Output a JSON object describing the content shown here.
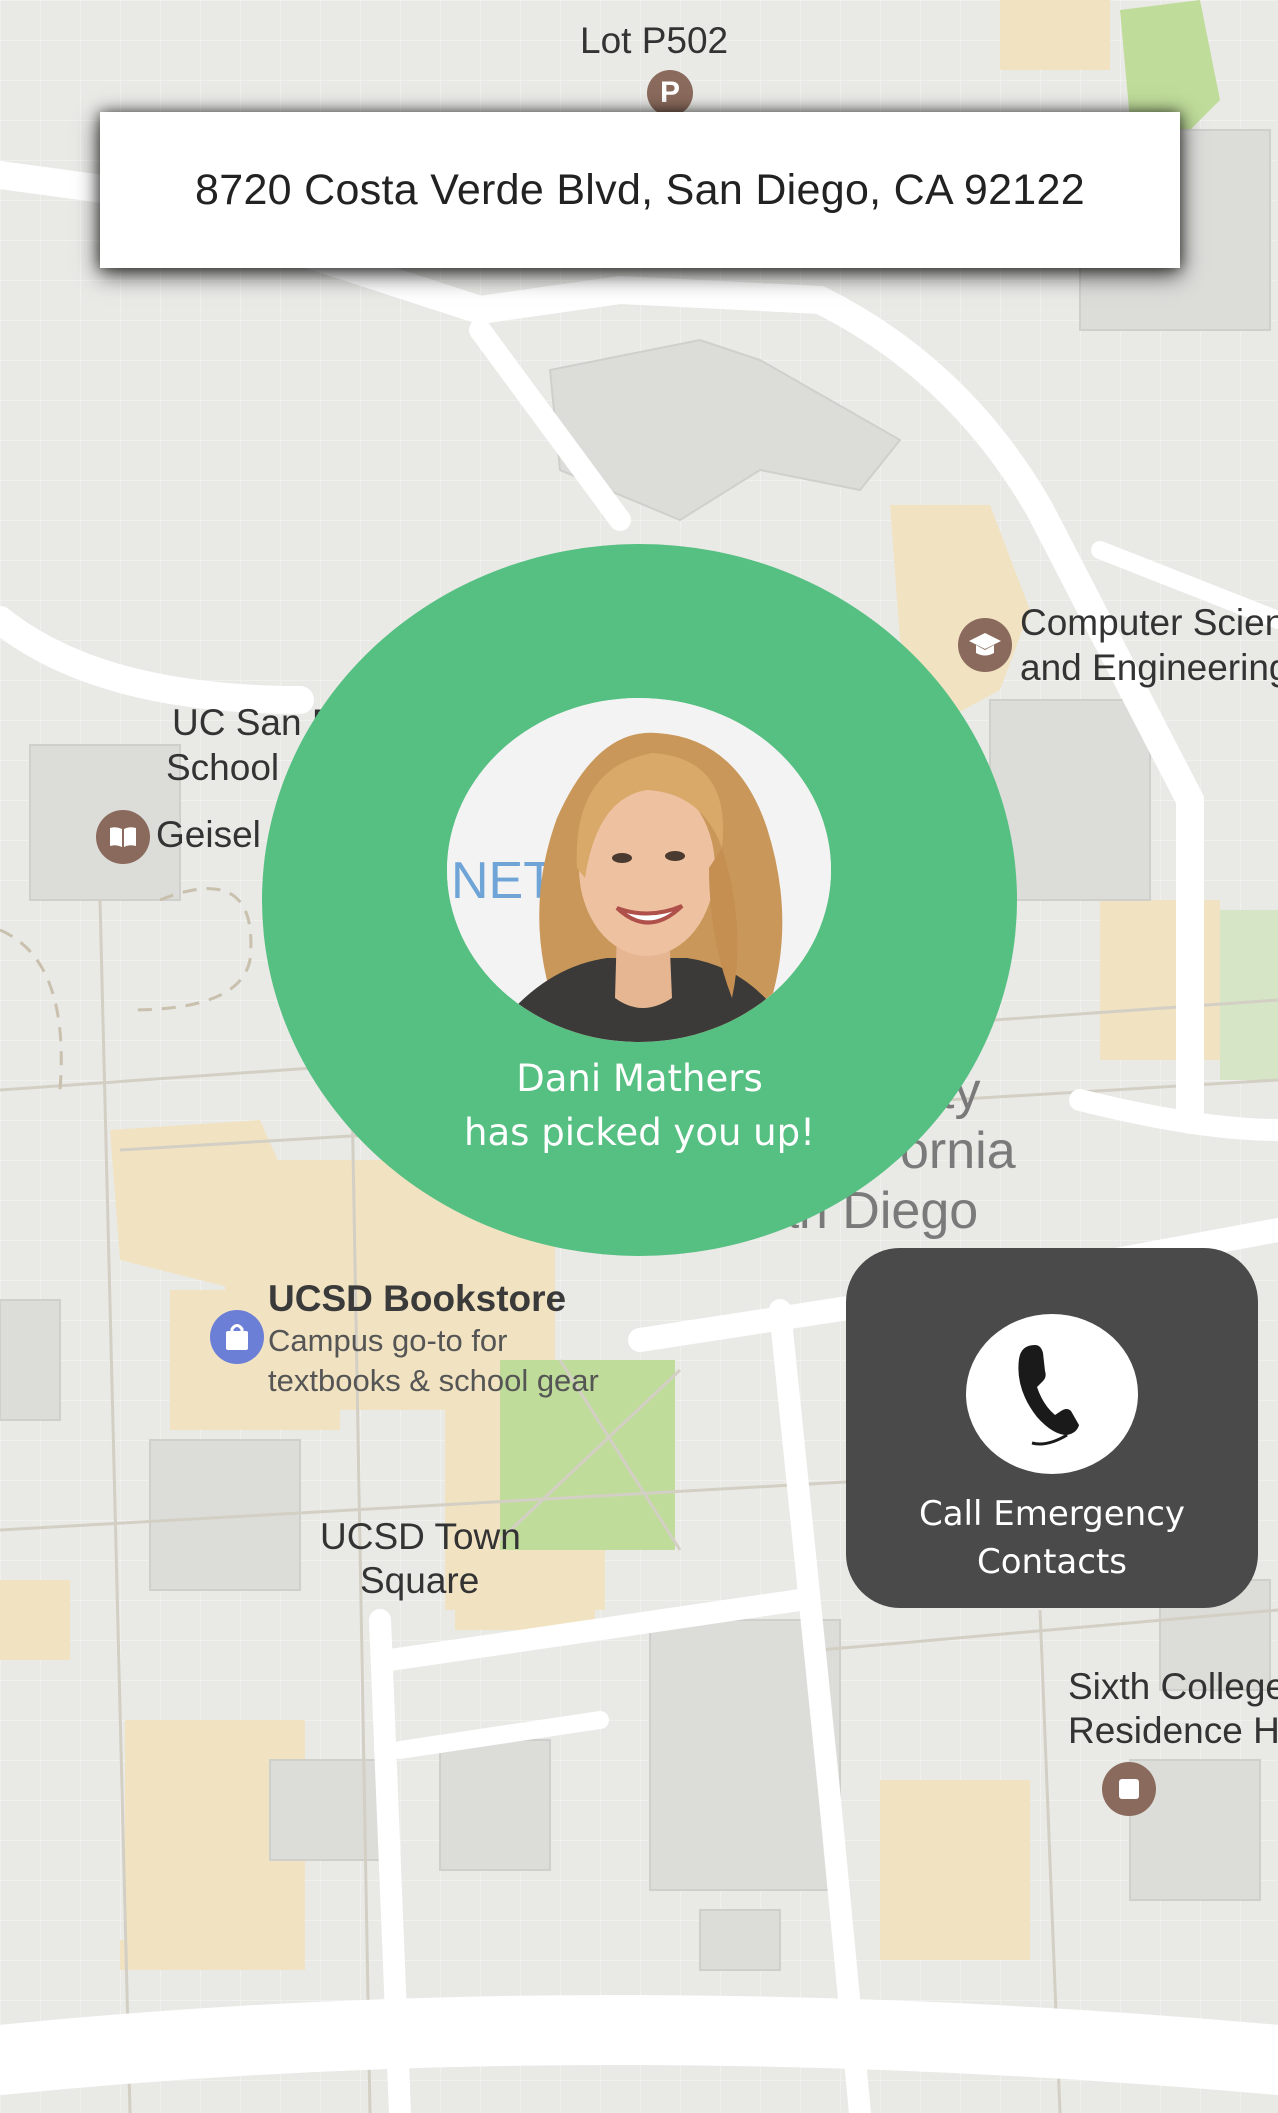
{
  "map": {
    "labels": {
      "lot": "Lot P502",
      "cse_line1": "Computer Scien",
      "cse_line2": "and Engineering",
      "ucsd_school_line1": "UC San D",
      "ucsd_school_line2": "School",
      "geisel": "Geisel",
      "bookstore_title": "UCSD Bookstore",
      "bookstore_desc_line1": "Campus go-to for",
      "bookstore_desc_line2": "textbooks & school gear",
      "town_square_line1": "UCSD Town",
      "town_square_line2": "Square",
      "sixth_line1": "Sixth College",
      "sixth_line2": "Residence H",
      "campus_line1": "ty",
      "campus_line2": "ornia",
      "campus_line3": "an Diego"
    },
    "icons": {
      "parking": "parking-icon",
      "graduation": "graduation-cap-icon",
      "library": "book-icon",
      "shopping": "shopping-bag-icon",
      "residence": "building-icon"
    }
  },
  "address": {
    "text": "8720 Costa Verde Blvd, San Diego, CA 92122"
  },
  "pickup": {
    "driver_name": "Dani Mathers",
    "message": "has picked you up!",
    "shirt_text": "NET"
  },
  "emergency": {
    "label_line1": "Call Emergency",
    "label_line2": "Contacts"
  },
  "colors": {
    "accent_green": "#56bf82",
    "emergency_bg": "#4a4a4a",
    "map_bg": "#e9e9e6",
    "building_tan": "#f1e3c2",
    "park_green": "#bfdc9a",
    "poi_brown": "#8a6a5c",
    "poi_blue": "#6b7fd6"
  }
}
